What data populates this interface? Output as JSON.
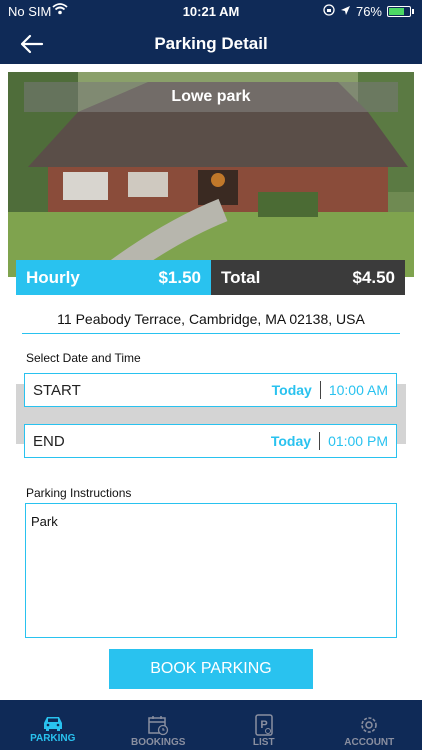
{
  "status_bar": {
    "carrier": "No SIM",
    "time": "10:21 AM",
    "battery": "76%",
    "battery_level": 0.76
  },
  "nav": {
    "title": "Parking Detail",
    "back_icon": "back-arrow-icon"
  },
  "parking": {
    "name": "Lowe park",
    "hourly_label": "Hourly",
    "hourly_rate": "$1.50",
    "total_label": "Total",
    "total_amount": "$4.50",
    "address": "11 Peabody Terrace, Cambridge, MA 02138, USA"
  },
  "schedule": {
    "section_label": "Select Date and Time",
    "start": {
      "label": "START",
      "day": "Today",
      "time": "10:00 AM"
    },
    "end": {
      "label": "END",
      "day": "Today",
      "time": "01:00 PM"
    }
  },
  "instructions": {
    "label": "Parking Instructions",
    "text": "Park"
  },
  "book_button": "BOOK PARKING",
  "colors": {
    "navy": "#0f2a57",
    "accent": "#29c2ef",
    "dark": "#3b3b3b"
  },
  "tabs": [
    {
      "label": "PARKING",
      "icon": "car-icon",
      "active": true
    },
    {
      "label": "BOOKINGS",
      "icon": "calendar-icon",
      "active": false
    },
    {
      "label": "LIST",
      "icon": "parking-sign-icon",
      "active": false
    },
    {
      "label": "ACCOUNT",
      "icon": "gear-icon",
      "active": false
    }
  ]
}
